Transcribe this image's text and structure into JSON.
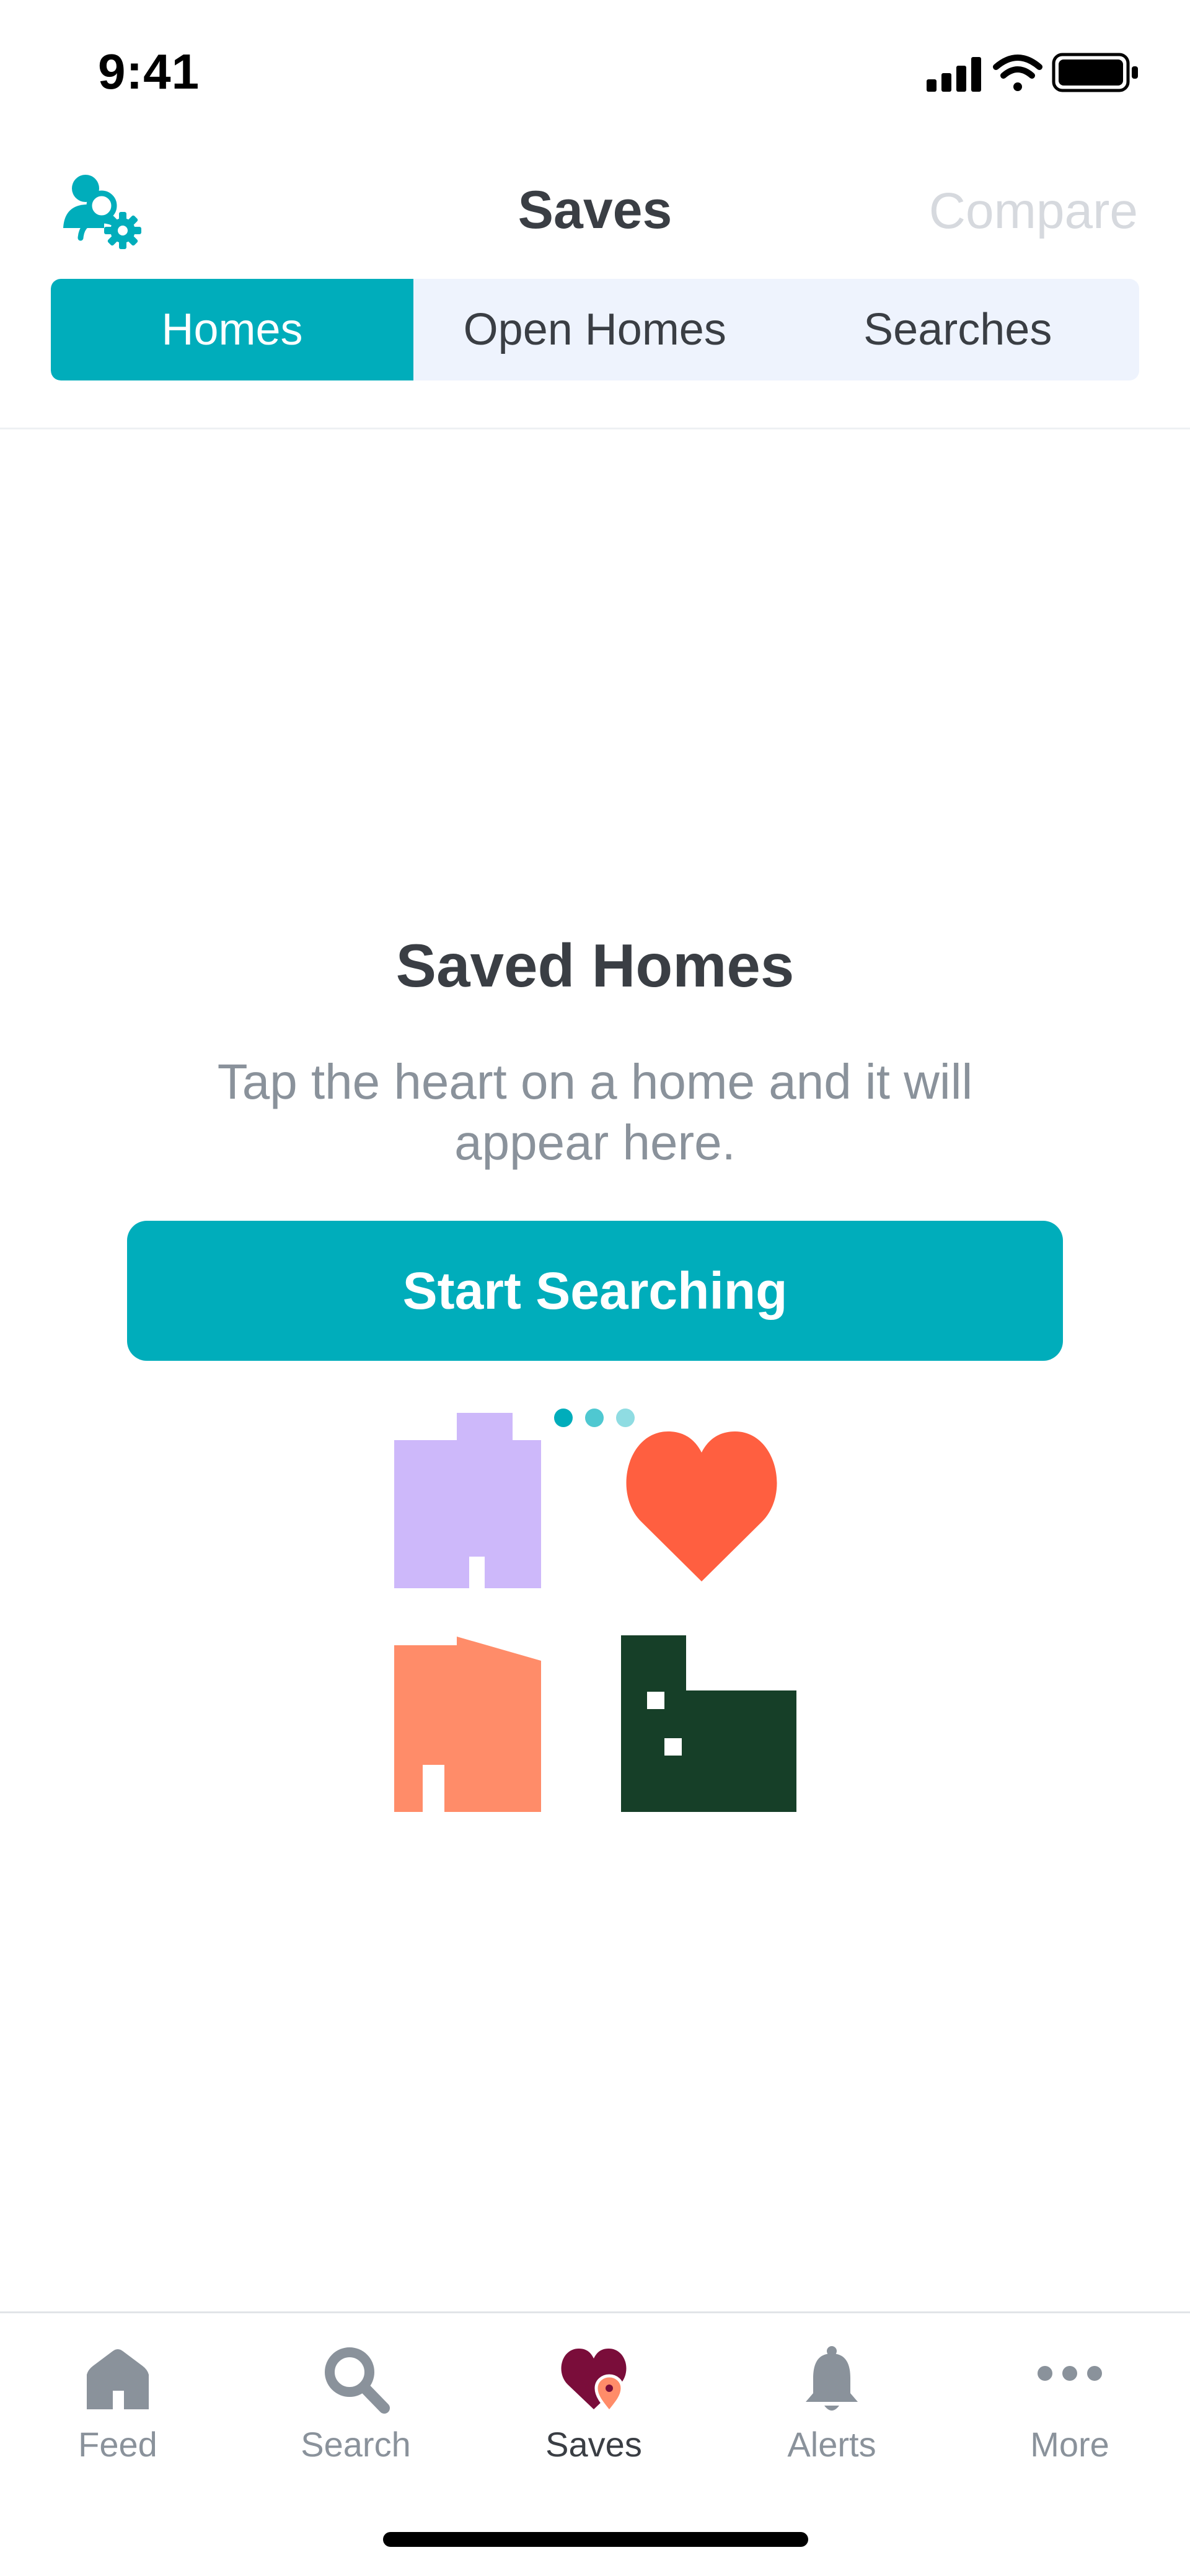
{
  "status_bar": {
    "time": "9:41"
  },
  "header": {
    "title": "Saves",
    "compare_label": "Compare"
  },
  "tabs": [
    {
      "label": "Homes",
      "active": true
    },
    {
      "label": "Open Homes",
      "active": false
    },
    {
      "label": "Searches",
      "active": false
    }
  ],
  "empty_state": {
    "title": "Saved Homes",
    "description": "Tap the heart on a home and it will appear here.",
    "button_label": "Start Searching"
  },
  "tab_bar": [
    {
      "label": "Feed",
      "icon": "home-icon",
      "active": false
    },
    {
      "label": "Search",
      "icon": "search-icon",
      "active": false
    },
    {
      "label": "Saves",
      "icon": "heart-icon",
      "active": true
    },
    {
      "label": "Alerts",
      "icon": "bell-icon",
      "active": false
    },
    {
      "label": "More",
      "icon": "more-icon",
      "active": false
    }
  ],
  "colors": {
    "accent": "#00adbb",
    "text_primary": "#3a3e44",
    "text_secondary": "#8a929b",
    "tab_inactive_bg": "#eef3fd",
    "compare_disabled": "#d6d9de",
    "illustration_lilac": "#cdb8fa",
    "illustration_heart": "#ff5f40",
    "illustration_salmon": "#ff8c69",
    "illustration_green": "#163f28",
    "saves_heart": "#7a0d3a",
    "saves_pin": "#ff8c69"
  }
}
